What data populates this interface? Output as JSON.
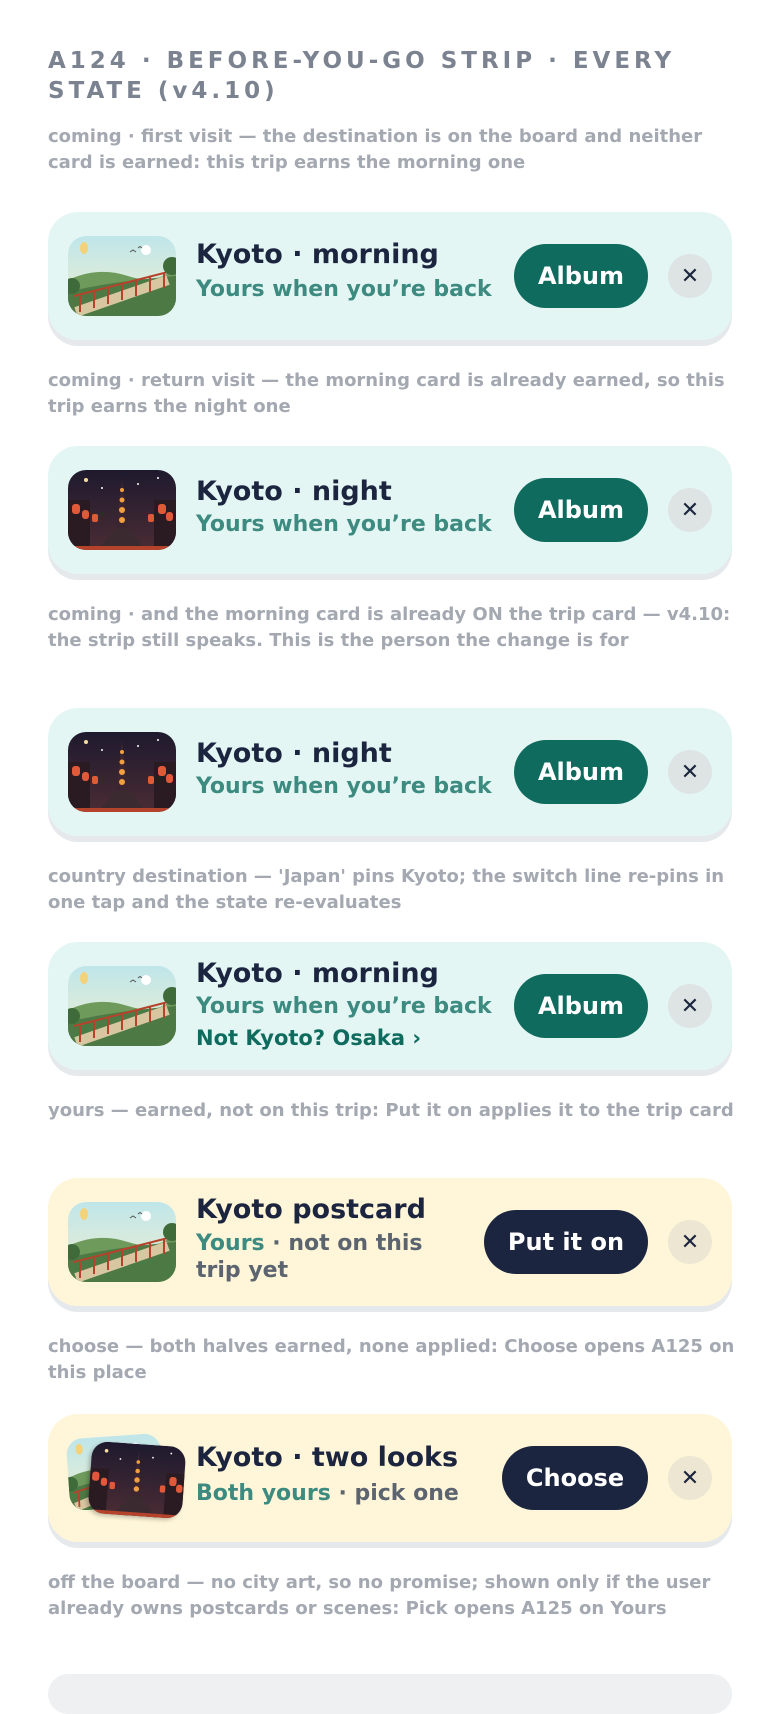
{
  "page": {
    "title": "A124 · BEFORE-YOU-GO STRIP · EVERY STATE (v4.10)"
  },
  "captions": [
    "coming · first visit — the destination is on the board and neither card is earned: this trip earns the morning one",
    "coming · return visit — the morning card is already earned, so this trip earns the night one",
    "coming · and the morning card is already ON the trip card — v4.10: the strip still speaks. This is the person the change is for",
    "country destination — 'Japan' pins Kyoto; the switch line re-pins in one tap and the state re-evaluates",
    "yours — earned, not on this trip: Put it on applies it to the trip card",
    "choose — both halves earned, none applied: Choose opens A125 on this place",
    "off the board — no city art, so no promise; shown only if the user already owns postcards or scenes: Pick opens A125 on Yours"
  ],
  "cards": [
    {
      "title": "Kyoto · morning",
      "subtitle": "Yours when you’re back",
      "button": "Album",
      "close": "✕",
      "art": "morning-postcard"
    },
    {
      "title": "Kyoto · night",
      "subtitle": "Yours when you’re back",
      "button": "Album",
      "close": "✕",
      "art": "night-postcard"
    },
    {
      "title": "Kyoto · night",
      "subtitle": "Yours when you’re back",
      "button": "Album",
      "close": "✕",
      "art": "night-postcard"
    },
    {
      "title": "Kyoto · morning",
      "subtitle": "Yours when you’re back",
      "switch_line": "Not Kyoto? Osaka ›",
      "button": "Album",
      "close": "✕",
      "art": "morning-postcard"
    },
    {
      "title": "Kyoto postcard",
      "subtitle_yours": "Yours",
      "subtitle_rest": " · not on this trip yet",
      "button": "Put it on",
      "close": "✕",
      "art": "morning-postcard"
    },
    {
      "title": "Kyoto · two looks",
      "subtitle_yours": "Both yours",
      "subtitle_rest": " · pick one",
      "button": "Choose",
      "close": "✕",
      "art": "morning-and-night-postcards"
    }
  ],
  "colors": {
    "mint_card": "#e4f6f3",
    "cream_card": "#fff6d9",
    "teal_button": "#0f6b5e",
    "navy_button": "#1c2540",
    "teal_text": "#3c8a80",
    "caption_gray": "#a3a8b1"
  }
}
